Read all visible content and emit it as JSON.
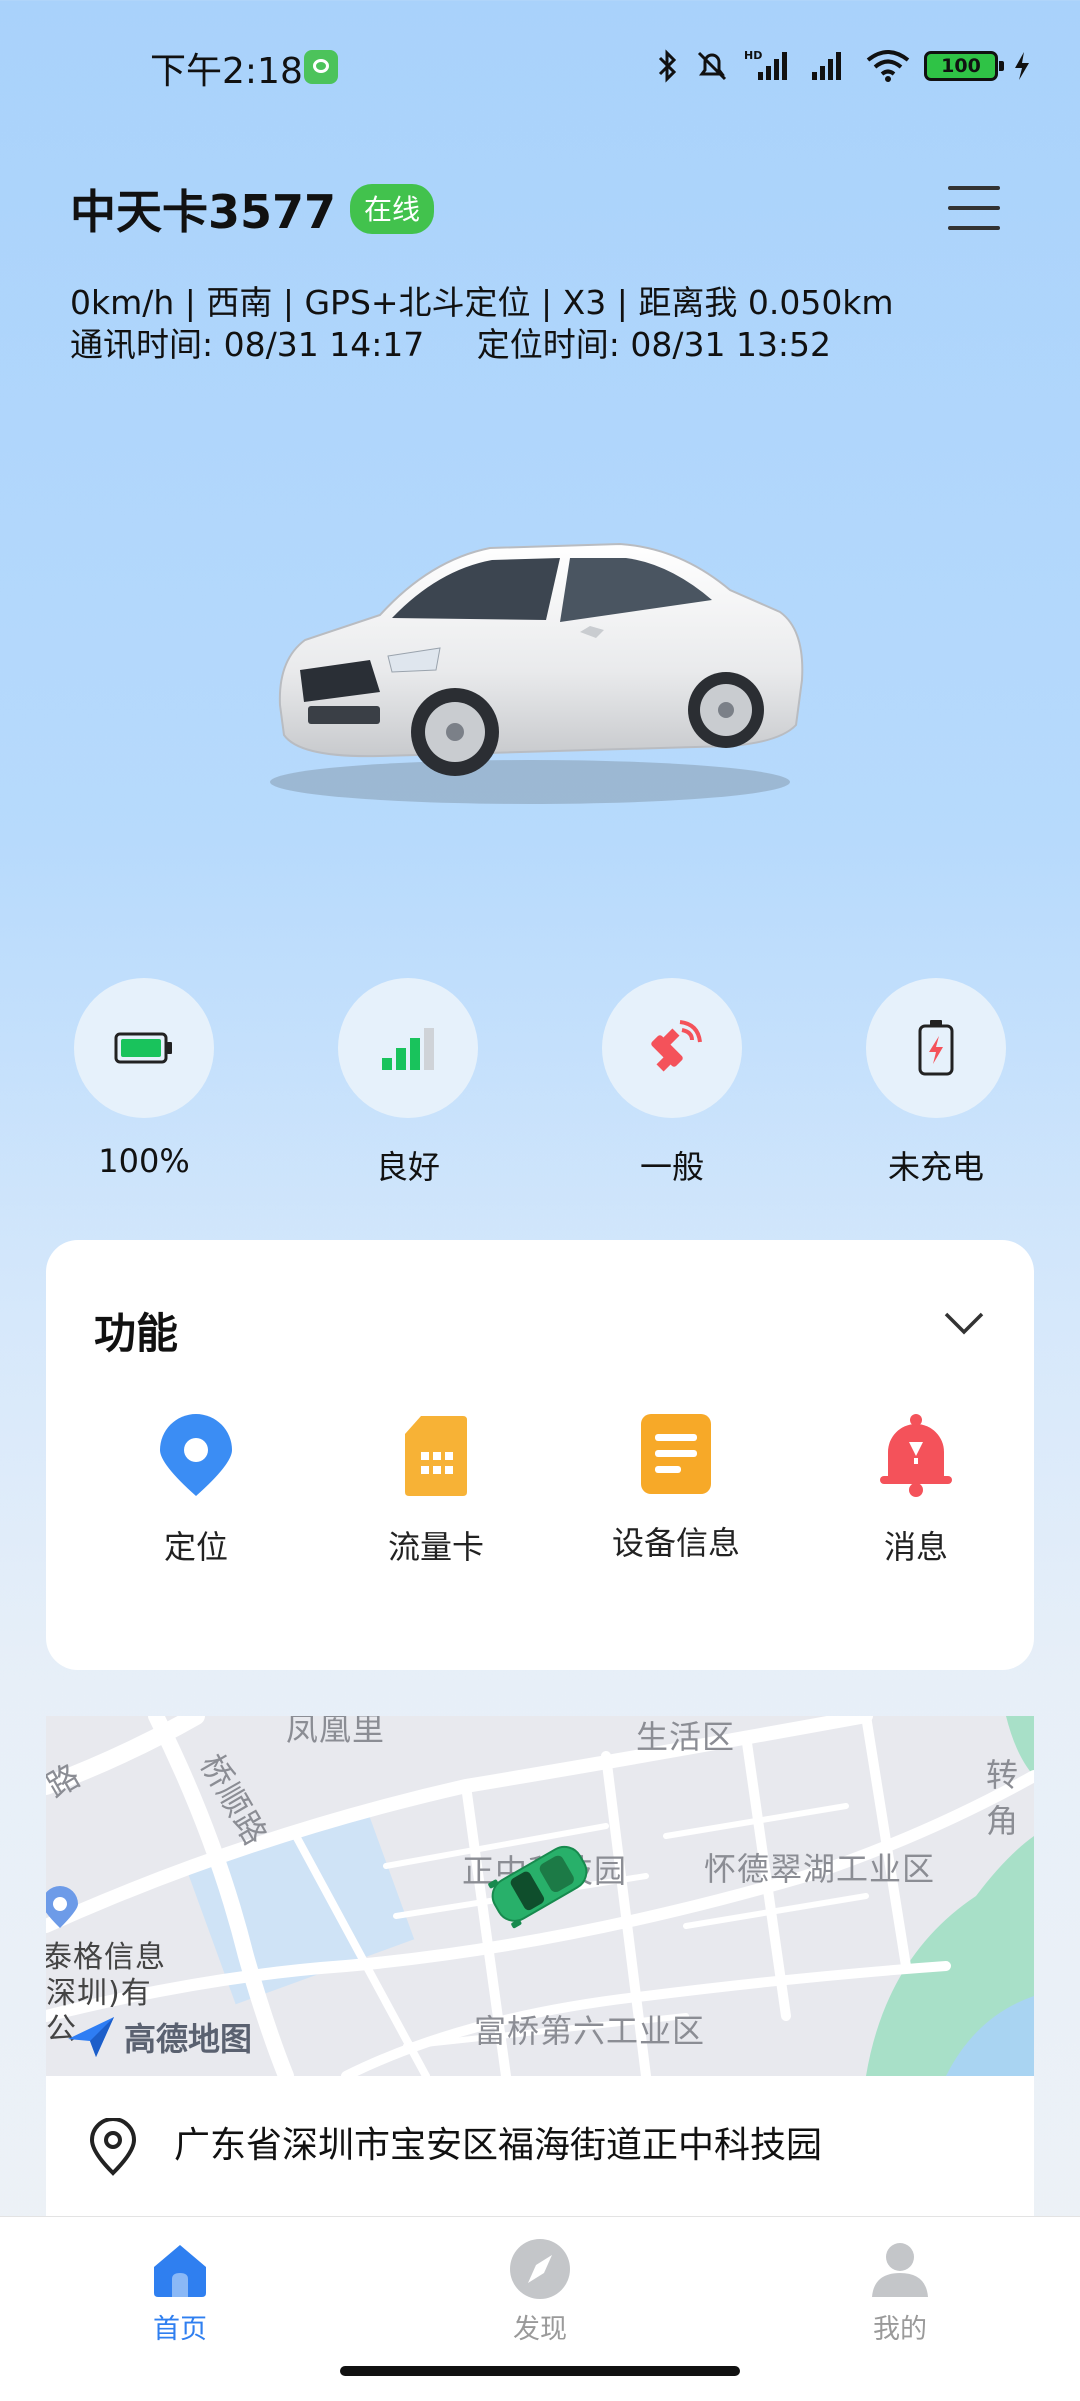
{
  "status_bar": {
    "time": "下午2:18",
    "battery_level": "100",
    "icons": [
      "bluetooth-icon",
      "mute-icon",
      "signal-hd-icon",
      "signal-icon",
      "wifi-icon",
      "battery-icon",
      "charging-icon"
    ]
  },
  "header": {
    "device_name": "中天卡3577",
    "status_badge": "在线",
    "menu_icon": "hamburger-menu-icon"
  },
  "info": {
    "line1": "0km/h | 西南 | GPS+北斗定位 | X3 | 距离我 0.050km",
    "line2": "通讯时间: 08/31 14:17     定位时间: 08/31 13:52"
  },
  "status_tiles": [
    {
      "icon": "battery-full-icon",
      "label": "100%"
    },
    {
      "icon": "signal-strength-icon",
      "label": "良好"
    },
    {
      "icon": "satellite-icon",
      "label": "一般"
    },
    {
      "icon": "charging-status-icon",
      "label": "未充电"
    }
  ],
  "functions": {
    "title": "功能",
    "items": [
      {
        "icon": "location-pin-icon",
        "label": "定位"
      },
      {
        "icon": "sim-card-icon",
        "label": "流量卡"
      },
      {
        "icon": "document-icon",
        "label": "设备信息"
      },
      {
        "icon": "bell-icon",
        "label": "消息"
      }
    ]
  },
  "map": {
    "provider": "高德地图",
    "labels": [
      "凤凰里",
      "生活区",
      "桥顺路",
      "路",
      "转角",
      "正中科技园",
      "怀德翠湖工业区",
      "泰格信息",
      "深圳)有",
      "公",
      "富桥第六工业区"
    ]
  },
  "address": "广东省深圳市宝安区福海街道正中科技园",
  "bottom_nav": [
    {
      "label": "首页",
      "icon": "home-icon",
      "active": true
    },
    {
      "label": "发现",
      "icon": "compass-icon",
      "active": false
    },
    {
      "label": "我的",
      "icon": "profile-icon",
      "active": false
    }
  ],
  "colors": {
    "accent": "#2f7ff0",
    "online": "#42c24d",
    "battery": "#19c35c",
    "warning": "#f5a623",
    "alert": "#f4525a"
  }
}
